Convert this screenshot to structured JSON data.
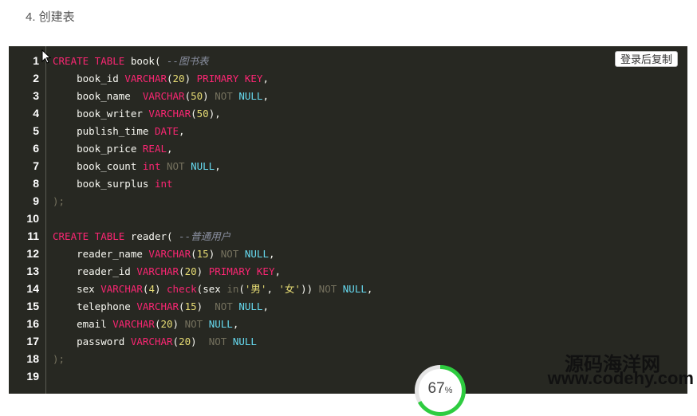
{
  "section_heading": "4. 创建表",
  "copy_button_label": "登录后复制",
  "code_lines": [
    {
      "n": "1",
      "tokens": [
        {
          "t": "kw",
          "v": "CREATE TABLE "
        },
        {
          "t": "plain",
          "v": "book( "
        },
        {
          "t": "cmt",
          "v": "--图书表"
        }
      ]
    },
    {
      "n": "2",
      "tokens": [
        {
          "t": "plain",
          "v": "    book_id "
        },
        {
          "t": "kw",
          "v": "VARCHAR"
        },
        {
          "t": "plain",
          "v": "("
        },
        {
          "t": "num",
          "v": "20"
        },
        {
          "t": "plain",
          "v": ") "
        },
        {
          "t": "kw",
          "v": "PRIMARY KEY"
        },
        {
          "t": "plain",
          "v": ","
        }
      ]
    },
    {
      "n": "3",
      "tokens": [
        {
          "t": "plain",
          "v": "    book_name  "
        },
        {
          "t": "kw",
          "v": "VARCHAR"
        },
        {
          "t": "plain",
          "v": "("
        },
        {
          "t": "num",
          "v": "50"
        },
        {
          "t": "plain",
          "v": ") "
        },
        {
          "t": "gray",
          "v": "NOT "
        },
        {
          "t": "nt",
          "v": "NULL"
        },
        {
          "t": "plain",
          "v": ","
        }
      ]
    },
    {
      "n": "4",
      "tokens": [
        {
          "t": "plain",
          "v": "    book_writer "
        },
        {
          "t": "kw",
          "v": "VARCHAR"
        },
        {
          "t": "plain",
          "v": "("
        },
        {
          "t": "num",
          "v": "50"
        },
        {
          "t": "plain",
          "v": "),"
        }
      ]
    },
    {
      "n": "5",
      "tokens": [
        {
          "t": "plain",
          "v": "    publish_time "
        },
        {
          "t": "kw",
          "v": "DATE"
        },
        {
          "t": "plain",
          "v": ","
        }
      ]
    },
    {
      "n": "6",
      "tokens": [
        {
          "t": "plain",
          "v": "    book_price "
        },
        {
          "t": "kw",
          "v": "REAL"
        },
        {
          "t": "plain",
          "v": ","
        }
      ]
    },
    {
      "n": "7",
      "tokens": [
        {
          "t": "plain",
          "v": "    book_count "
        },
        {
          "t": "kw",
          "v": "int "
        },
        {
          "t": "gray",
          "v": "NOT "
        },
        {
          "t": "nt",
          "v": "NULL"
        },
        {
          "t": "plain",
          "v": ","
        }
      ]
    },
    {
      "n": "8",
      "tokens": [
        {
          "t": "plain",
          "v": "    book_surplus "
        },
        {
          "t": "kw",
          "v": "int"
        }
      ]
    },
    {
      "n": "9",
      "tokens": [
        {
          "t": "gray",
          "v": ");"
        }
      ]
    },
    {
      "n": "10",
      "tokens": []
    },
    {
      "n": "11",
      "tokens": [
        {
          "t": "kw",
          "v": "CREATE TABLE "
        },
        {
          "t": "plain",
          "v": "reader( "
        },
        {
          "t": "cmt",
          "v": "--普通用户"
        }
      ]
    },
    {
      "n": "12",
      "tokens": [
        {
          "t": "plain",
          "v": "    reader_name "
        },
        {
          "t": "kw",
          "v": "VARCHAR"
        },
        {
          "t": "plain",
          "v": "("
        },
        {
          "t": "num",
          "v": "15"
        },
        {
          "t": "plain",
          "v": ") "
        },
        {
          "t": "gray",
          "v": "NOT "
        },
        {
          "t": "nt",
          "v": "NULL"
        },
        {
          "t": "plain",
          "v": ","
        }
      ]
    },
    {
      "n": "13",
      "tokens": [
        {
          "t": "plain",
          "v": "    reader_id "
        },
        {
          "t": "kw",
          "v": "VARCHAR"
        },
        {
          "t": "plain",
          "v": "("
        },
        {
          "t": "num",
          "v": "20"
        },
        {
          "t": "plain",
          "v": ") "
        },
        {
          "t": "kw",
          "v": "PRIMARY KEY"
        },
        {
          "t": "plain",
          "v": ","
        }
      ]
    },
    {
      "n": "14",
      "tokens": [
        {
          "t": "plain",
          "v": "    sex "
        },
        {
          "t": "kw",
          "v": "VARCHAR"
        },
        {
          "t": "plain",
          "v": "("
        },
        {
          "t": "num",
          "v": "4"
        },
        {
          "t": "plain",
          "v": ") "
        },
        {
          "t": "kw",
          "v": "check"
        },
        {
          "t": "plain",
          "v": "(sex "
        },
        {
          "t": "gray",
          "v": "in"
        },
        {
          "t": "plain",
          "v": "("
        },
        {
          "t": "str",
          "v": "'男'"
        },
        {
          "t": "plain",
          "v": ", "
        },
        {
          "t": "str",
          "v": "'女'"
        },
        {
          "t": "plain",
          "v": ")) "
        },
        {
          "t": "gray",
          "v": "NOT "
        },
        {
          "t": "nt",
          "v": "NULL"
        },
        {
          "t": "plain",
          "v": ","
        }
      ]
    },
    {
      "n": "15",
      "tokens": [
        {
          "t": "plain",
          "v": "    telephone "
        },
        {
          "t": "kw",
          "v": "VARCHAR"
        },
        {
          "t": "plain",
          "v": "("
        },
        {
          "t": "num",
          "v": "15"
        },
        {
          "t": "plain",
          "v": ")  "
        },
        {
          "t": "gray",
          "v": "NOT "
        },
        {
          "t": "nt",
          "v": "NULL"
        },
        {
          "t": "plain",
          "v": ","
        }
      ]
    },
    {
      "n": "16",
      "tokens": [
        {
          "t": "plain",
          "v": "    email "
        },
        {
          "t": "kw",
          "v": "VARCHAR"
        },
        {
          "t": "plain",
          "v": "("
        },
        {
          "t": "num",
          "v": "20"
        },
        {
          "t": "plain",
          "v": ") "
        },
        {
          "t": "gray",
          "v": "NOT "
        },
        {
          "t": "nt",
          "v": "NULL"
        },
        {
          "t": "plain",
          "v": ","
        }
      ]
    },
    {
      "n": "17",
      "tokens": [
        {
          "t": "plain",
          "v": "    password "
        },
        {
          "t": "kw",
          "v": "VARCHAR"
        },
        {
          "t": "plain",
          "v": "("
        },
        {
          "t": "num",
          "v": "20"
        },
        {
          "t": "plain",
          "v": ")  "
        },
        {
          "t": "gray",
          "v": "NOT "
        },
        {
          "t": "nt",
          "v": "NULL"
        }
      ]
    },
    {
      "n": "18",
      "tokens": [
        {
          "t": "gray",
          "v": ");"
        }
      ]
    },
    {
      "n": "19",
      "tokens": []
    }
  ],
  "progress": {
    "value": "67",
    "unit": "%"
  },
  "watermark": {
    "line1": "源码海洋网",
    "line2": "www.codehy.com"
  },
  "colors": {
    "panel_bg": "#272822",
    "keyword": "#f92672",
    "null_keyword": "#66d9ef",
    "number": "#e6db74",
    "comment": "#8a8fa0",
    "progress_green": "#2ecc40"
  },
  "icons": {
    "cursor": "mouse-pointer-icon"
  }
}
